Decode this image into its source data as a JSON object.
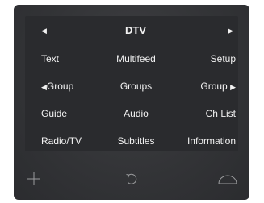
{
  "menu": {
    "title": "DTV",
    "prev_arrow": "◀",
    "next_arrow": "▶",
    "rows": [
      {
        "left": "Text",
        "middle": "Multifeed",
        "right": "Setup"
      },
      {
        "left_arrow": "◀",
        "left": "Group",
        "middle": "Groups",
        "right": "Group",
        "right_arrow": "▶"
      },
      {
        "left": "Guide",
        "middle": "Audio",
        "right": "Ch List"
      },
      {
        "left": "Radio/TV",
        "middle": "Subtitles",
        "right": "Information"
      }
    ]
  },
  "icons": {
    "plus": "plus-icon",
    "back": "back-arrow-icon",
    "home": "home-arc-icon"
  },
  "colors": {
    "bezel": "#333437",
    "screen": "#2a2b2e",
    "text": "#f2f2f2",
    "icon": "#9a9b9d"
  }
}
